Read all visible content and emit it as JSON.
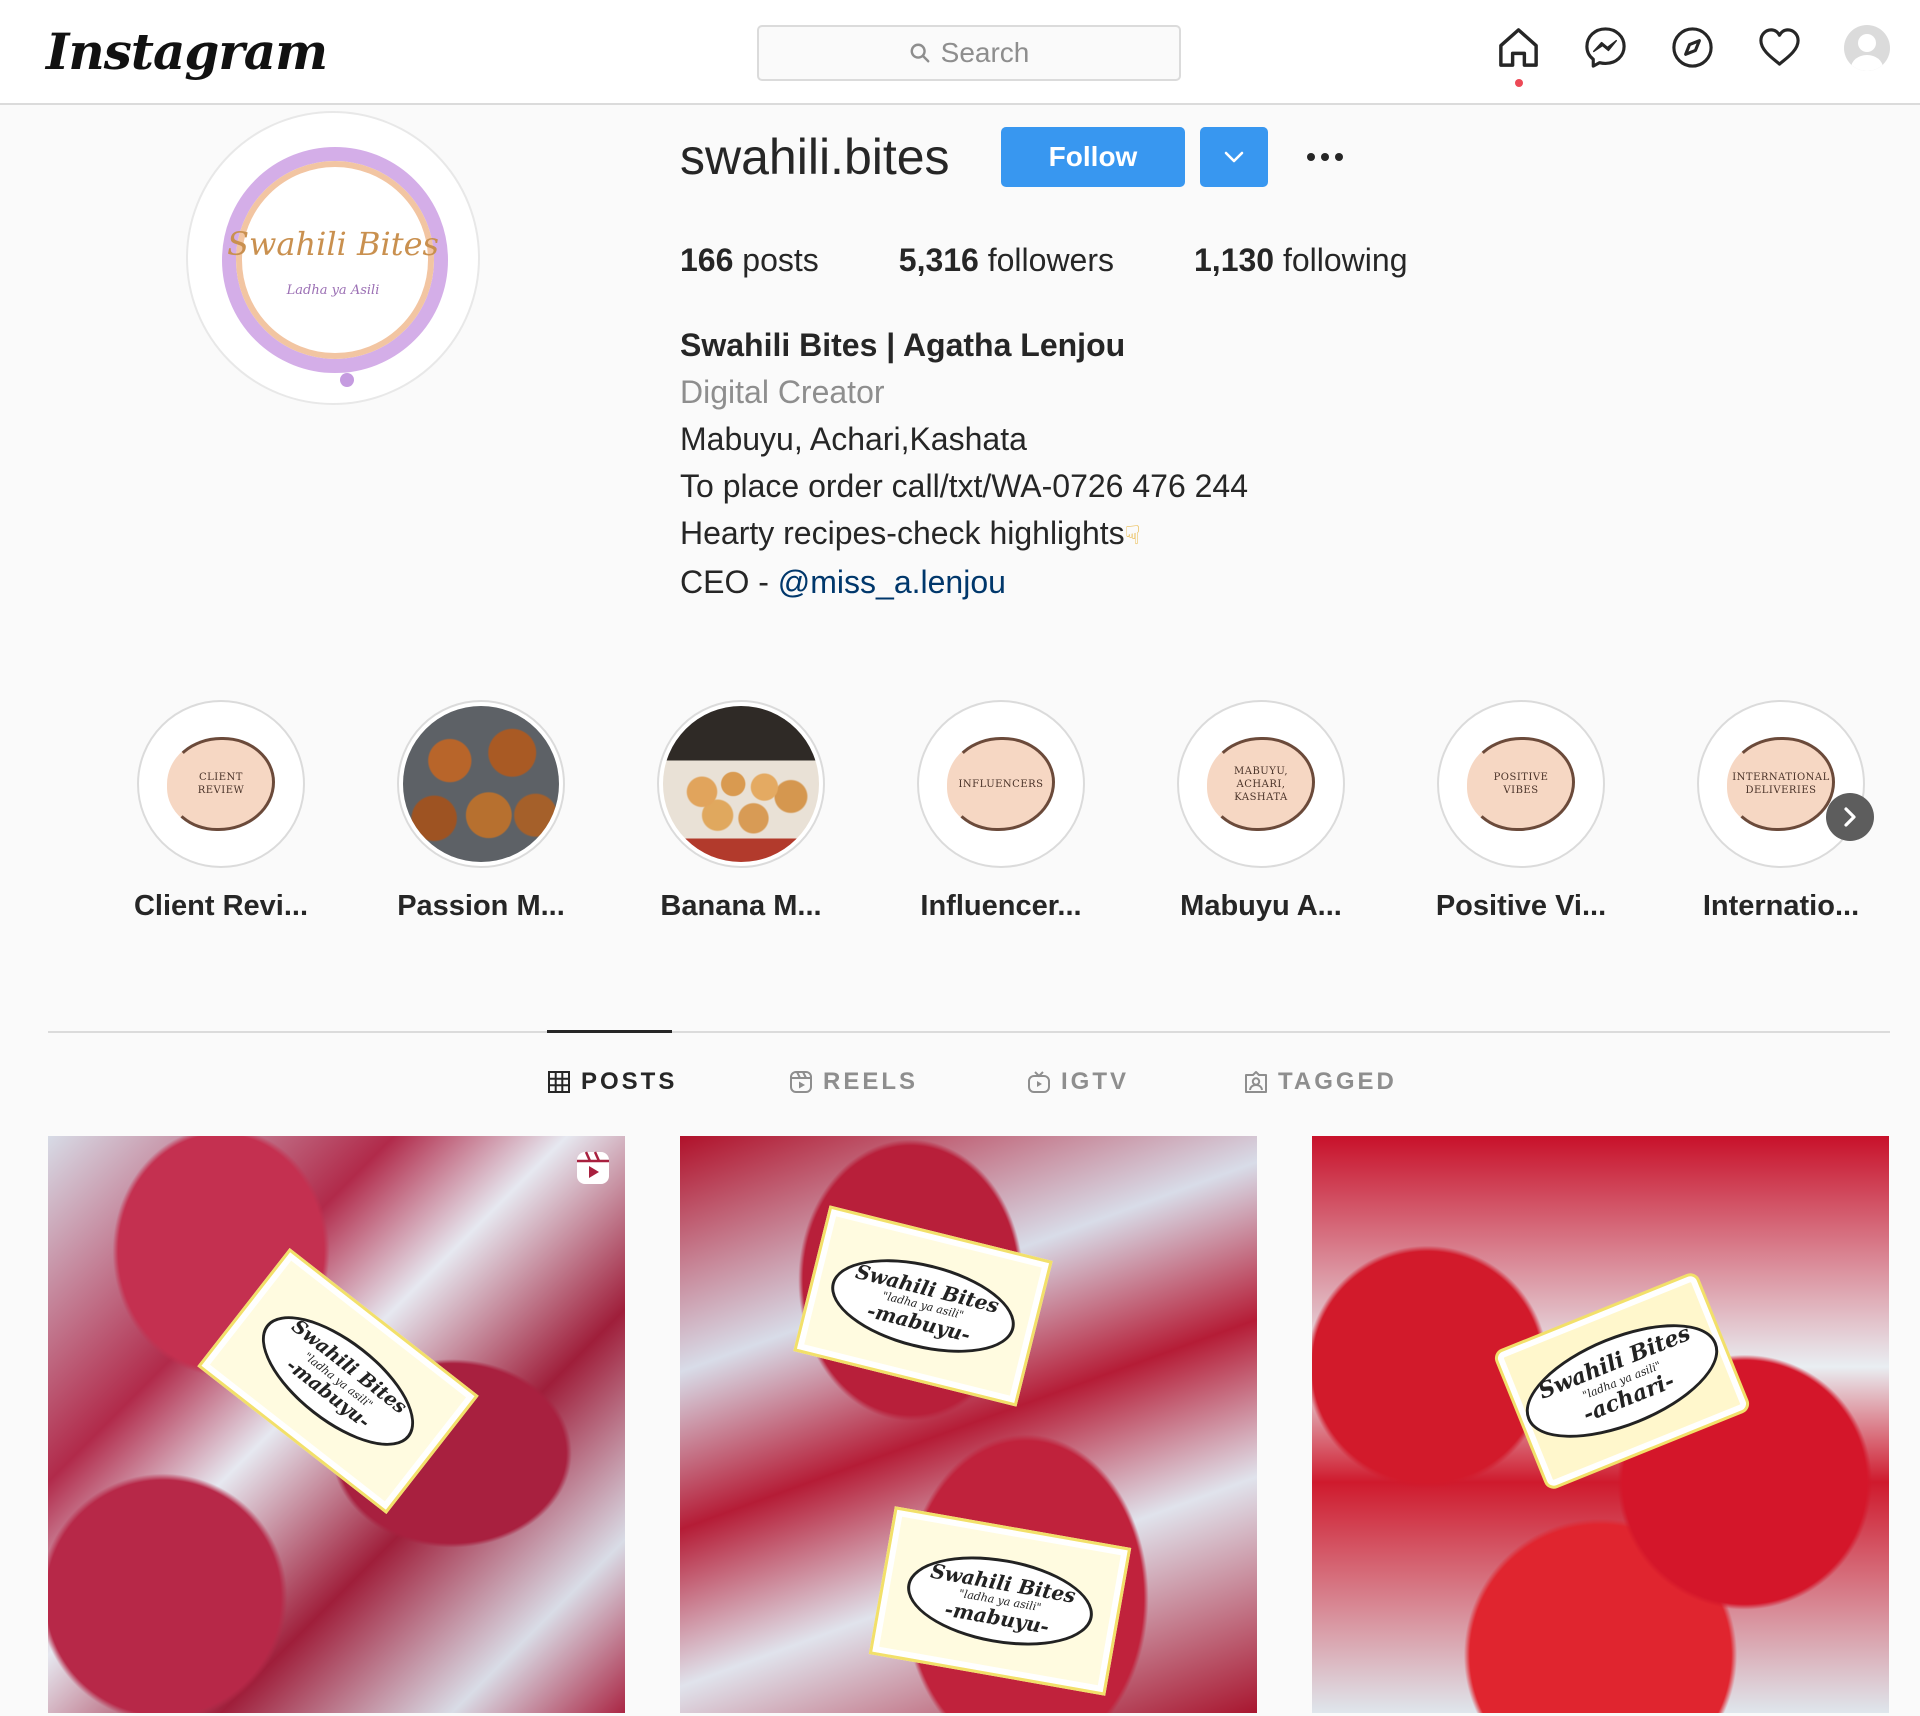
{
  "nav": {
    "logo": "Instagram",
    "search_placeholder": "Search",
    "icons": [
      "home-icon",
      "messenger-icon",
      "explore-icon",
      "heart-icon",
      "profile-avatar"
    ]
  },
  "profile": {
    "username": "swahili.bites",
    "follow_label": "Follow",
    "pic_brand": "Swahili Bites",
    "pic_tagline": "Ladha ya Asili",
    "stats": {
      "posts_count": "166",
      "posts_label": "posts",
      "followers_count": "5,316",
      "followers_label": "followers",
      "following_count": "1,130",
      "following_label": "following"
    },
    "bio": {
      "full_name": "Swahili Bites | Agatha Lenjou",
      "category": "Digital Creator",
      "line1": "Mabuyu, Achari,Kashata",
      "line2": "To place order call/txt/WA-0726 476 244",
      "line3": "Hearty recipes-check highlights",
      "line4_prefix": "CEO - ",
      "mention": "@miss_a.lenjou"
    }
  },
  "highlights": [
    {
      "label": "Client Revi...",
      "cover_text": "CLIENT REVIEW"
    },
    {
      "label": "Passion M...",
      "cover_text": ""
    },
    {
      "label": "Banana M...",
      "cover_text": ""
    },
    {
      "label": "Influencer...",
      "cover_text": "INFLUENCERS"
    },
    {
      "label": "Mabuyu A...",
      "cover_text": "MABUYU, ACHARI, KASHATA"
    },
    {
      "label": "Positive Vi...",
      "cover_text": "POSITIVE VIBES"
    },
    {
      "label": "Internatio...",
      "cover_text": "INTERNATIONAL DELIVERIES"
    }
  ],
  "tabs": {
    "posts": "POSTS",
    "reels": "REELS",
    "igtv": "IGTV",
    "tagged": "TAGGED",
    "active": "posts"
  },
  "posts": [
    {
      "label_brand": "Swahili Bites",
      "label_tagline": "\"ladha ya asili\"",
      "label_product": "-mabuyu-",
      "is_reel": true
    },
    {
      "label_brand": "Swahili Bites",
      "label_tagline": "\"ladha ya asili\"",
      "label_product": "-mabuyu-",
      "is_reel": false
    },
    {
      "label_brand": "Swahili Bites",
      "label_tagline": "\"ladha ya asili\"",
      "label_product": "-achari-",
      "is_reel": false
    }
  ],
  "colors": {
    "follow_blue": "#3897f0",
    "link_navy": "#00376b",
    "notification_red": "#ed4956"
  }
}
